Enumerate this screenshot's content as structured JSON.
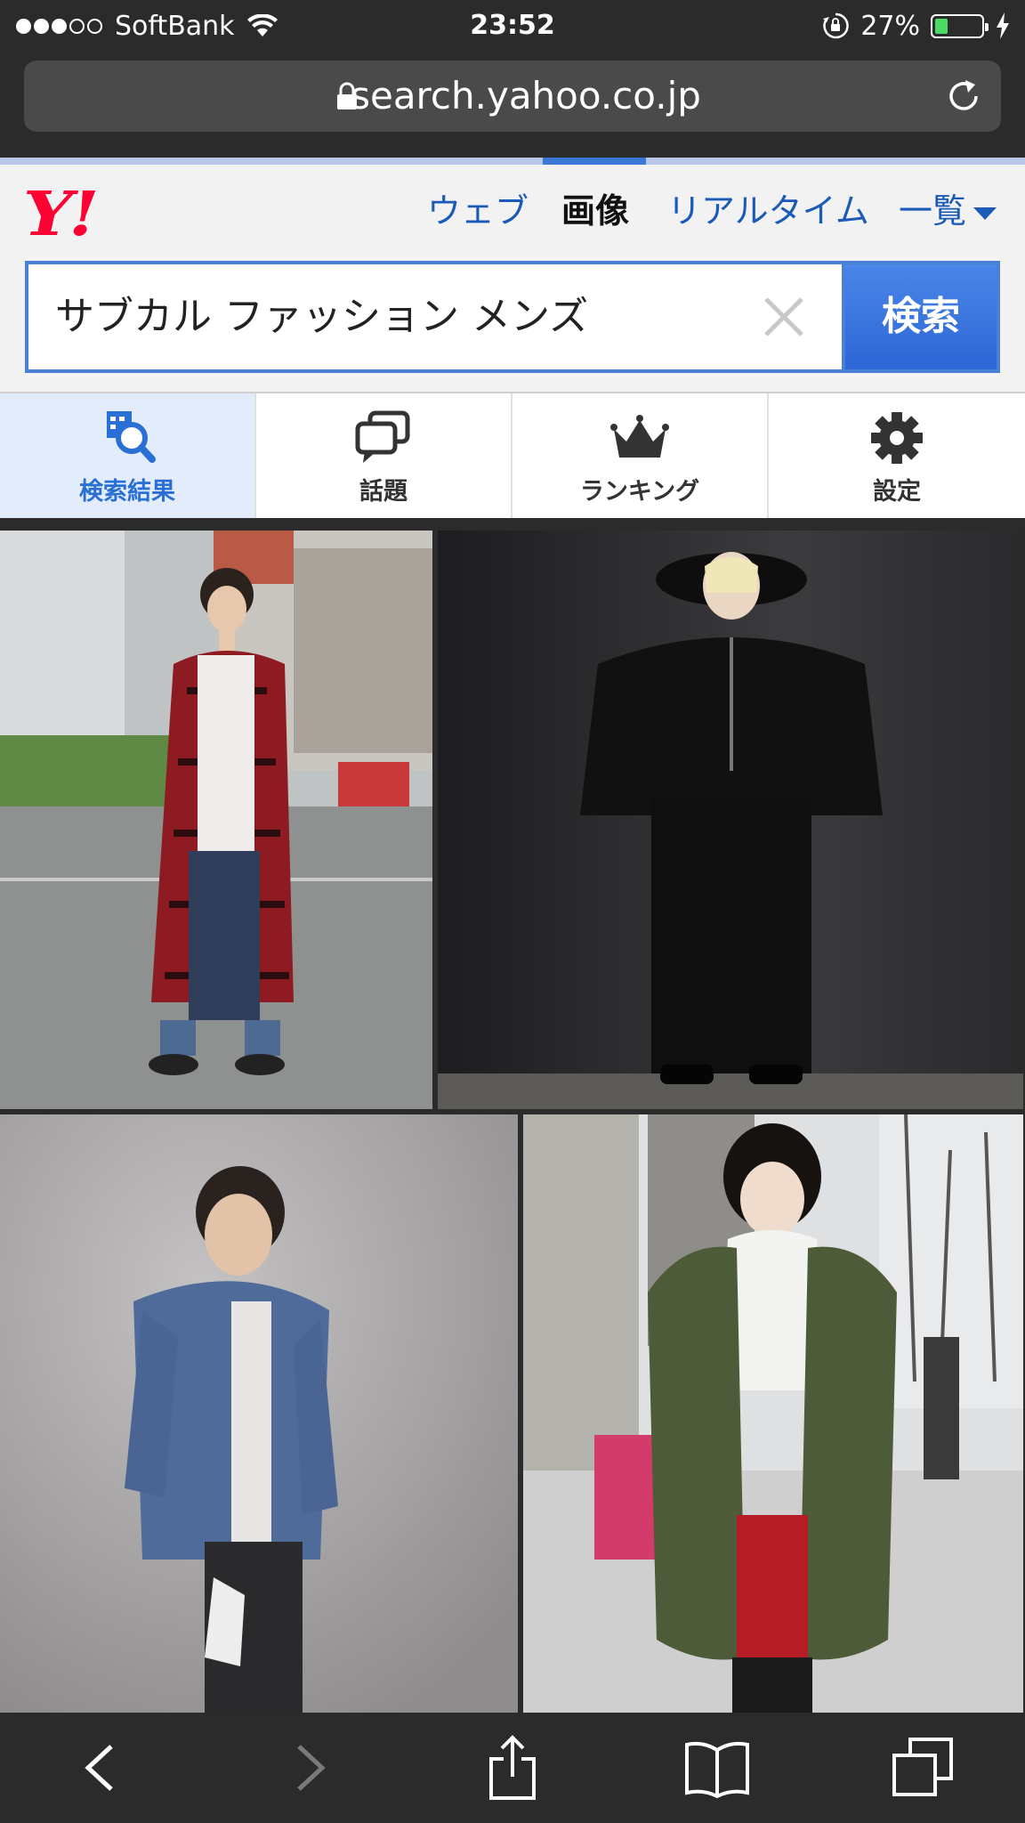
{
  "status_bar": {
    "carrier": "SoftBank",
    "time": "23:52",
    "battery_percent": "27%",
    "battery_level": 0.27,
    "signal_bars_filled": 3,
    "signal_bars_total": 5
  },
  "browser": {
    "url": "search.yahoo.co.jp"
  },
  "header": {
    "logo": "Y!",
    "nav": [
      "ウェブ",
      "画像",
      "リアルタイム",
      "一覧"
    ],
    "active_nav": "画像",
    "query": "サブカル ファッション メンズ",
    "search_button": "検索"
  },
  "tabs": [
    {
      "label": "検索結果",
      "icon": "search-results-icon",
      "active": true
    },
    {
      "label": "話題",
      "icon": "speech-bubbles-icon",
      "active": false
    },
    {
      "label": "ランキング",
      "icon": "crown-icon",
      "active": false
    },
    {
      "label": "設定",
      "icon": "gear-icon",
      "active": false
    }
  ],
  "colors": {
    "yahoo_red": "#ff0033",
    "link_blue": "#1c5ab8",
    "accent_blue": "#2d66d6",
    "active_tab_bg": "#e3ecfb"
  },
  "results": [
    {
      "icon": "photo-red-plaid-coat"
    },
    {
      "icon": "photo-black-poncho-hat"
    },
    {
      "icon": "photo-blue-jacket"
    },
    {
      "icon": "photo-green-parka"
    }
  ],
  "toolbar": [
    "back-icon",
    "forward-icon",
    "share-icon",
    "bookmarks-icon",
    "tabs-icon"
  ]
}
